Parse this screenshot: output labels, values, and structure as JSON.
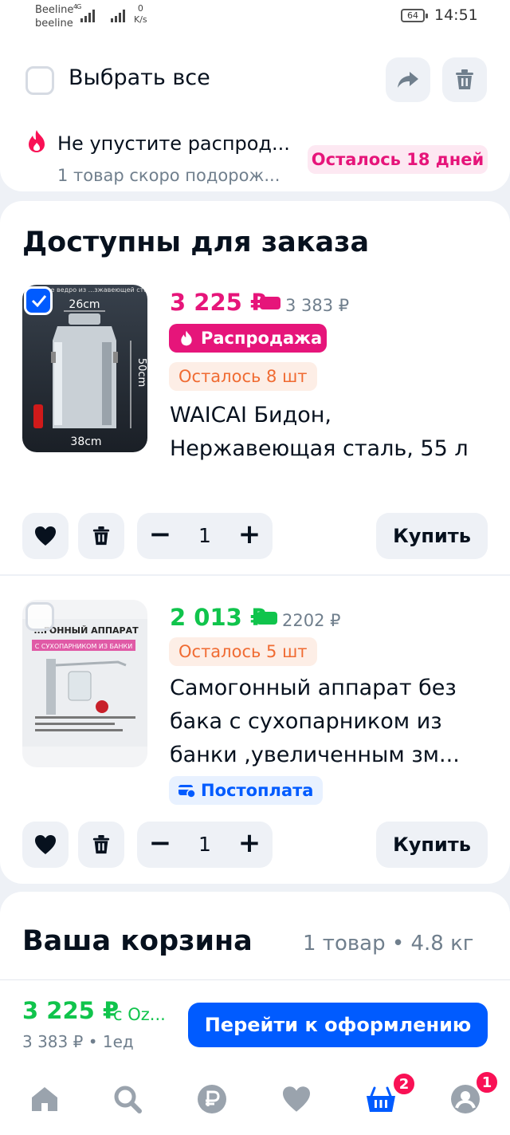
{
  "status_bar": {
    "carrier_1": "Beeline",
    "carrier_2": "beeline",
    "network": "4G",
    "speed_value": "0",
    "speed_unit": "K/s",
    "battery": "64",
    "time": "14:51"
  },
  "header": {
    "select_all_label": "Выбрать все",
    "share_icon": "share-icon",
    "delete_icon": "trash-icon"
  },
  "promo": {
    "title": "Не упустите распрод...",
    "subtitle": "1 товар скоро подорож...",
    "badge": "Осталось 18 дней"
  },
  "section": {
    "title": "Доступны для заказа"
  },
  "products": [
    {
      "checked": true,
      "price": "3 225 ₽",
      "old_price": "3 383 ₽",
      "sale_badge": "Распродажа",
      "stock_badge": "Осталось 8 шт",
      "name": "WAICAI Бидон, Нержавеющая сталь, 55 л",
      "image_labels": {
        "top_text": "...тительное ведро из ...зжавеющей стали",
        "width": "26cm",
        "height": "50cm",
        "base": "38cm"
      },
      "quantity": "1",
      "minus": "−",
      "plus": "+",
      "buy_label": "Купить",
      "price_color": "#e6157a"
    },
    {
      "checked": false,
      "price": "2 013 ₽",
      "old_price": "2202 ₽",
      "stock_badge": "Осталось 5 шт",
      "name": "Самогонный аппарат без бака с сухопарником из банки ,увеличенным зм...",
      "payment_badge": "Постоплата",
      "image_labels": {
        "title": "...ГОННЫЙ АППАРАТ",
        "subtitle": "С СУХОПАРНИКОМ ИЗ БАНКИ"
      },
      "quantity": "1",
      "minus": "−",
      "plus": "+",
      "buy_label": "Купить",
      "price_color": "#10c44c"
    }
  ],
  "cart": {
    "title": "Ваша корзина",
    "meta": "1 товар • 4.8 кг"
  },
  "checkout": {
    "total": "3 225 ₽",
    "total_source": "с Oz...",
    "subtotal": "3 383 ₽ • 1ед",
    "button_label": "Перейти к оформлению"
  },
  "nav": {
    "items": [
      {
        "icon": "home-icon"
      },
      {
        "icon": "search-icon"
      },
      {
        "icon": "ruble-icon"
      },
      {
        "icon": "heart-icon"
      },
      {
        "icon": "cart-icon",
        "badge": "2"
      },
      {
        "icon": "profile-icon",
        "badge": "1"
      }
    ]
  },
  "colors": {
    "accent": "#005bff",
    "sale": "#e6157a",
    "discount_green": "#10c44c",
    "stock_orange": "#f06b32",
    "badge_red": "#f91155"
  }
}
